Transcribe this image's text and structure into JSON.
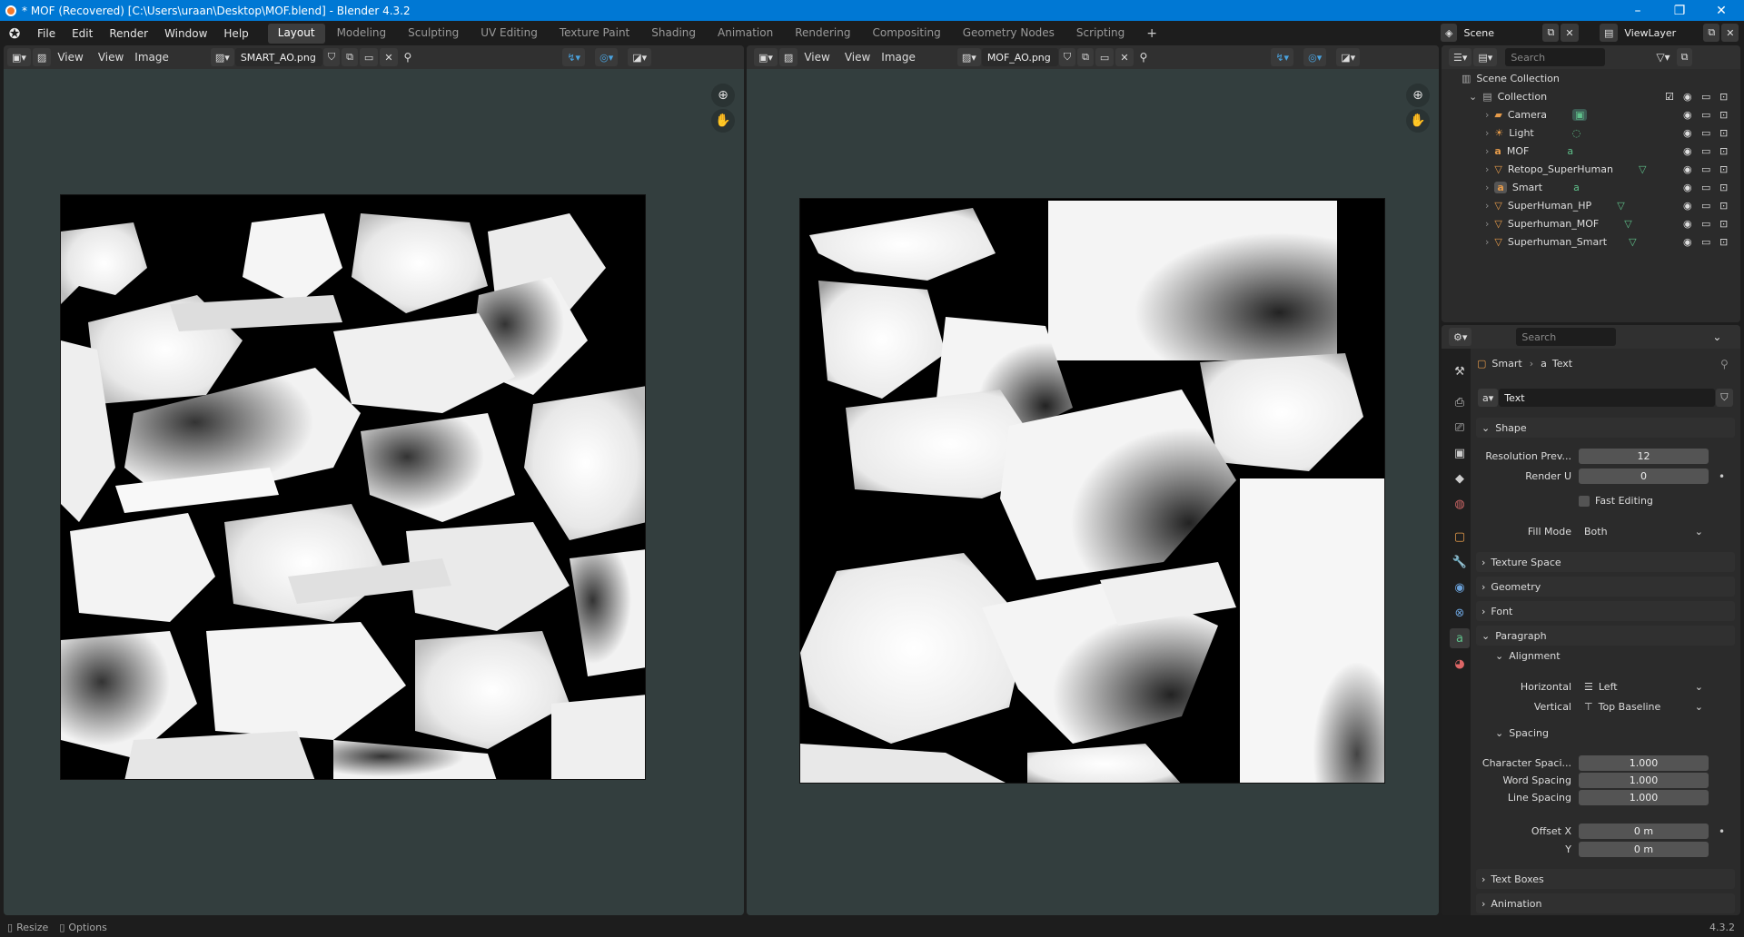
{
  "window": {
    "title": "* MOF (Recovered) [C:\\Users\\uraan\\Desktop\\MOF.blend] - Blender 4.3.2",
    "minimize": "–",
    "maximize": "❐",
    "close": "✕"
  },
  "menus": [
    "File",
    "Edit",
    "Render",
    "Window",
    "Help"
  ],
  "workspaces": [
    "Layout",
    "Modeling",
    "Sculpting",
    "UV Editing",
    "Texture Paint",
    "Shading",
    "Animation",
    "Rendering",
    "Compositing",
    "Geometry Nodes",
    "Scripting"
  ],
  "add_workspace": "+",
  "scene": {
    "name": "Scene",
    "view_layer": "ViewLayer"
  },
  "left_editor": {
    "view": "View",
    "view2": "View",
    "image_menu": "Image",
    "image_name": "SMART_AO.png"
  },
  "right_editor": {
    "view": "View",
    "view2": "View",
    "image_menu": "Image",
    "image_name": "MOF_AO.png"
  },
  "outliner": {
    "search_placeholder": "Search",
    "root": "Scene Collection",
    "collection": "Collection",
    "items": [
      {
        "name": "Camera",
        "icon": "camera-icon"
      },
      {
        "name": "Light",
        "icon": "light-icon"
      },
      {
        "name": "MOF",
        "icon": "text-icon"
      },
      {
        "name": "Retopo_SuperHuman",
        "icon": "mesh-icon"
      },
      {
        "name": "Smart",
        "icon": "text-icon"
      },
      {
        "name": "SuperHuman_HP",
        "icon": "mesh-icon"
      },
      {
        "name": "Superhuman_MOF",
        "icon": "mesh-icon"
      },
      {
        "name": "Superhuman_Smart",
        "icon": "mesh-icon"
      }
    ]
  },
  "properties": {
    "search_placeholder": "Search",
    "breadcrumb_object": "Smart",
    "breadcrumb_data": "Text",
    "data_name": "Text",
    "sections": {
      "shape": "Shape",
      "texture_space": "Texture Space",
      "geometry": "Geometry",
      "font": "Font",
      "paragraph": "Paragraph",
      "alignment": "Alignment",
      "spacing": "Spacing",
      "text_boxes": "Text Boxes",
      "animation": "Animation"
    },
    "resolution_preview_label": "Resolution Prev...",
    "resolution_preview": "12",
    "render_u_label": "Render U",
    "render_u": "0",
    "fast_editing": "Fast Editing",
    "fill_mode_label": "Fill Mode",
    "fill_mode": "Both",
    "horizontal_label": "Horizontal",
    "horizontal": "Left",
    "vertical_label": "Vertical",
    "vertical": "Top Baseline",
    "char_spacing_label": "Character Spaci...",
    "char_spacing": "1.000",
    "word_spacing_label": "Word Spacing",
    "word_spacing": "1.000",
    "line_spacing_label": "Line Spacing",
    "line_spacing": "1.000",
    "offset_x_label": "Offset X",
    "offset_x": "0 m",
    "offset_y_label": "Y",
    "offset_y": "0 m"
  },
  "status": {
    "resize": "Resize",
    "options": "Options",
    "version": "4.3.2"
  }
}
